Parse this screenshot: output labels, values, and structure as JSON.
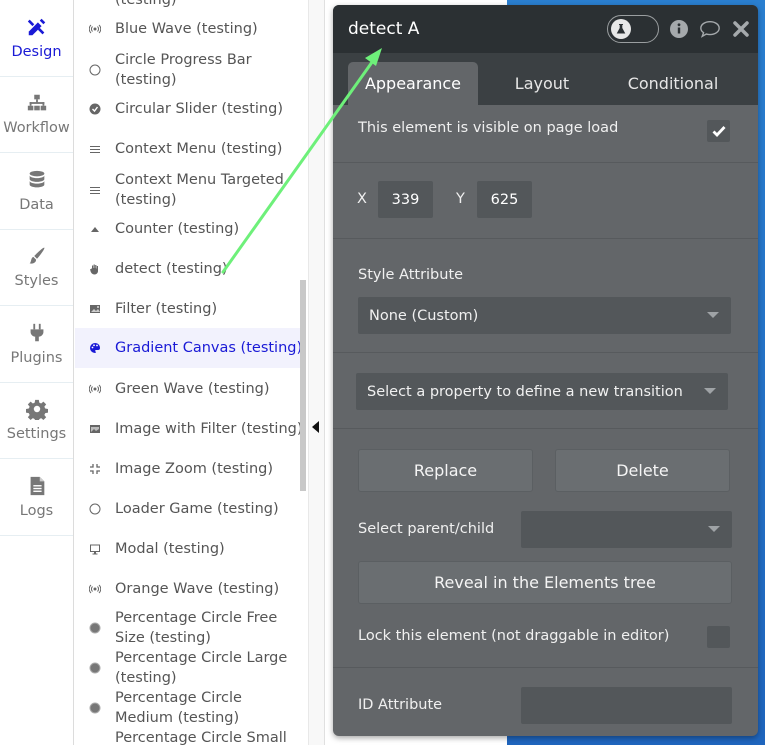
{
  "leftnav": {
    "items": [
      {
        "label": "Design",
        "icon": "design-tools-icon",
        "active": true
      },
      {
        "label": "Workflow",
        "icon": "workflow-sitemap-icon"
      },
      {
        "label": "Data",
        "icon": "database-icon"
      },
      {
        "label": "Styles",
        "icon": "paintbrush-icon"
      },
      {
        "label": "Plugins",
        "icon": "plug-icon"
      },
      {
        "label": "Settings",
        "icon": "gear-icon"
      },
      {
        "label": "Logs",
        "icon": "document-icon"
      }
    ]
  },
  "elements": {
    "items": [
      {
        "label": "(testing)",
        "icon": "none"
      },
      {
        "label": "Blue Wave (testing)",
        "icon": "broadcast-icon"
      },
      {
        "label": "Circle Progress Bar (testing)",
        "icon": "circle-outline-icon"
      },
      {
        "label": "Circular Slider (testing)",
        "icon": "check-circle-icon"
      },
      {
        "label": "Context Menu (testing)",
        "icon": "hamburger-icon"
      },
      {
        "label": "Context Menu Targeted (testing)",
        "icon": "hamburger-icon"
      },
      {
        "label": "Counter (testing)",
        "icon": "triangle-up-icon"
      },
      {
        "label": "detect (testing)",
        "icon": "hand-icon"
      },
      {
        "label": "Filter (testing)",
        "icon": "image-icon"
      },
      {
        "label": "Gradient Canvas (testing)",
        "icon": "palette-icon",
        "selected": true
      },
      {
        "label": "Green Wave (testing)",
        "icon": "broadcast-icon"
      },
      {
        "label": "Image with Filter (testing)",
        "icon": "images-icon"
      },
      {
        "label": "Image Zoom (testing)",
        "icon": "compress-icon"
      },
      {
        "label": "Loader Game (testing)",
        "icon": "circle-outline-icon"
      },
      {
        "label": "Modal (testing)",
        "icon": "monitor-icon"
      },
      {
        "label": "Orange Wave (testing)",
        "icon": "broadcast-icon"
      },
      {
        "label": "Percentage Circle Free Size (testing)",
        "icon": "filled-circle-icon"
      },
      {
        "label": "Percentage Circle Large (testing)",
        "icon": "filled-circle-icon"
      },
      {
        "label": "Percentage Circle Medium (testing)",
        "icon": "filled-circle-icon"
      },
      {
        "label": "Percentage Circle Small",
        "icon": "none"
      }
    ]
  },
  "panel": {
    "title": "detect A",
    "tools": {
      "toggle_icon": "flask-icon",
      "info_icon": "info-icon",
      "comment_icon": "comment-icon",
      "close_icon": "close-icon"
    },
    "tabs": [
      "Appearance",
      "Layout",
      "Conditional"
    ],
    "active_tab": "Appearance",
    "visible_label": "This element is visible on page load",
    "visible_checked": true,
    "x_label": "X",
    "x_value": "339",
    "y_label": "Y",
    "y_value": "625",
    "style_label": "Style Attribute",
    "style_value": "None (Custom)",
    "transition_placeholder": "Select a property to define a new transition",
    "replace_label": "Replace",
    "delete_label": "Delete",
    "parent_child_label": "Select parent/child",
    "parent_child_value": "",
    "reveal_label": "Reveal in the Elements tree",
    "lock_label": "Lock this element (not draggable in editor)",
    "lock_checked": false,
    "id_label": "ID Attribute",
    "id_value": ""
  },
  "colors": {
    "accent": "#1a1ad6",
    "panel_bg": "#636669",
    "panel_header": "#2b3033",
    "annotation_arrow": "#6ef07a",
    "canvas_blue": "#2a7fd0"
  }
}
